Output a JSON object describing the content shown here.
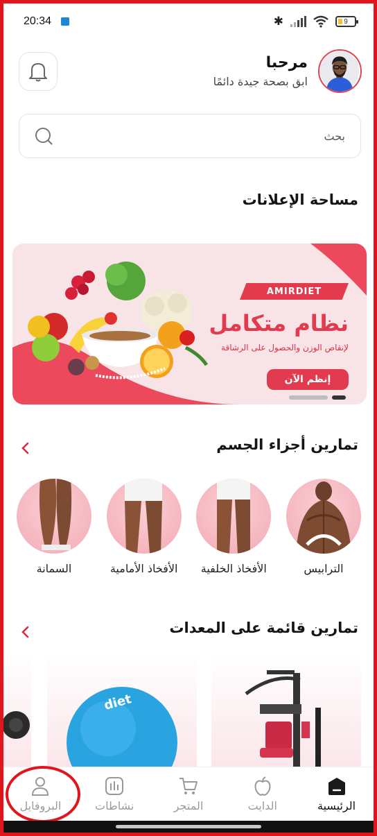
{
  "status_bar": {
    "time": "20:34",
    "battery": "9"
  },
  "header": {
    "greeting": "مرحبا",
    "subtitle": "ابق بصحة جيدة دائمًا"
  },
  "search": {
    "placeholder": "بحث"
  },
  "ads": {
    "title": "مساحة الإعلانات",
    "banner": {
      "brand": "AMIRDIET",
      "headline": "نظام متكامل",
      "tagline": "لإنقاص الوزن والحصول على الرشاقة",
      "cta": "إنظم الآن"
    }
  },
  "body_parts": {
    "title": "تمارين أجزاء الجسم",
    "items": [
      {
        "label": "الترابيس"
      },
      {
        "label": "الأفخاذ الخلفية"
      },
      {
        "label": "الأفخاذ الأمامية"
      },
      {
        "label": "السمانة"
      }
    ]
  },
  "equipment": {
    "title": "تمارين قائمة على المعدات",
    "ball_text": "diet"
  },
  "nav": {
    "items": [
      {
        "label": "الرئيسية",
        "icon": "home-icon",
        "active": true
      },
      {
        "label": "الدايت",
        "icon": "apple-icon"
      },
      {
        "label": "المتجر",
        "icon": "cart-icon"
      },
      {
        "label": "نشاطات",
        "icon": "activity-icon"
      },
      {
        "label": "البروفايل",
        "icon": "user-icon"
      }
    ]
  },
  "colors": {
    "accent": "#e23a4e",
    "highlight": "#e1161c"
  }
}
